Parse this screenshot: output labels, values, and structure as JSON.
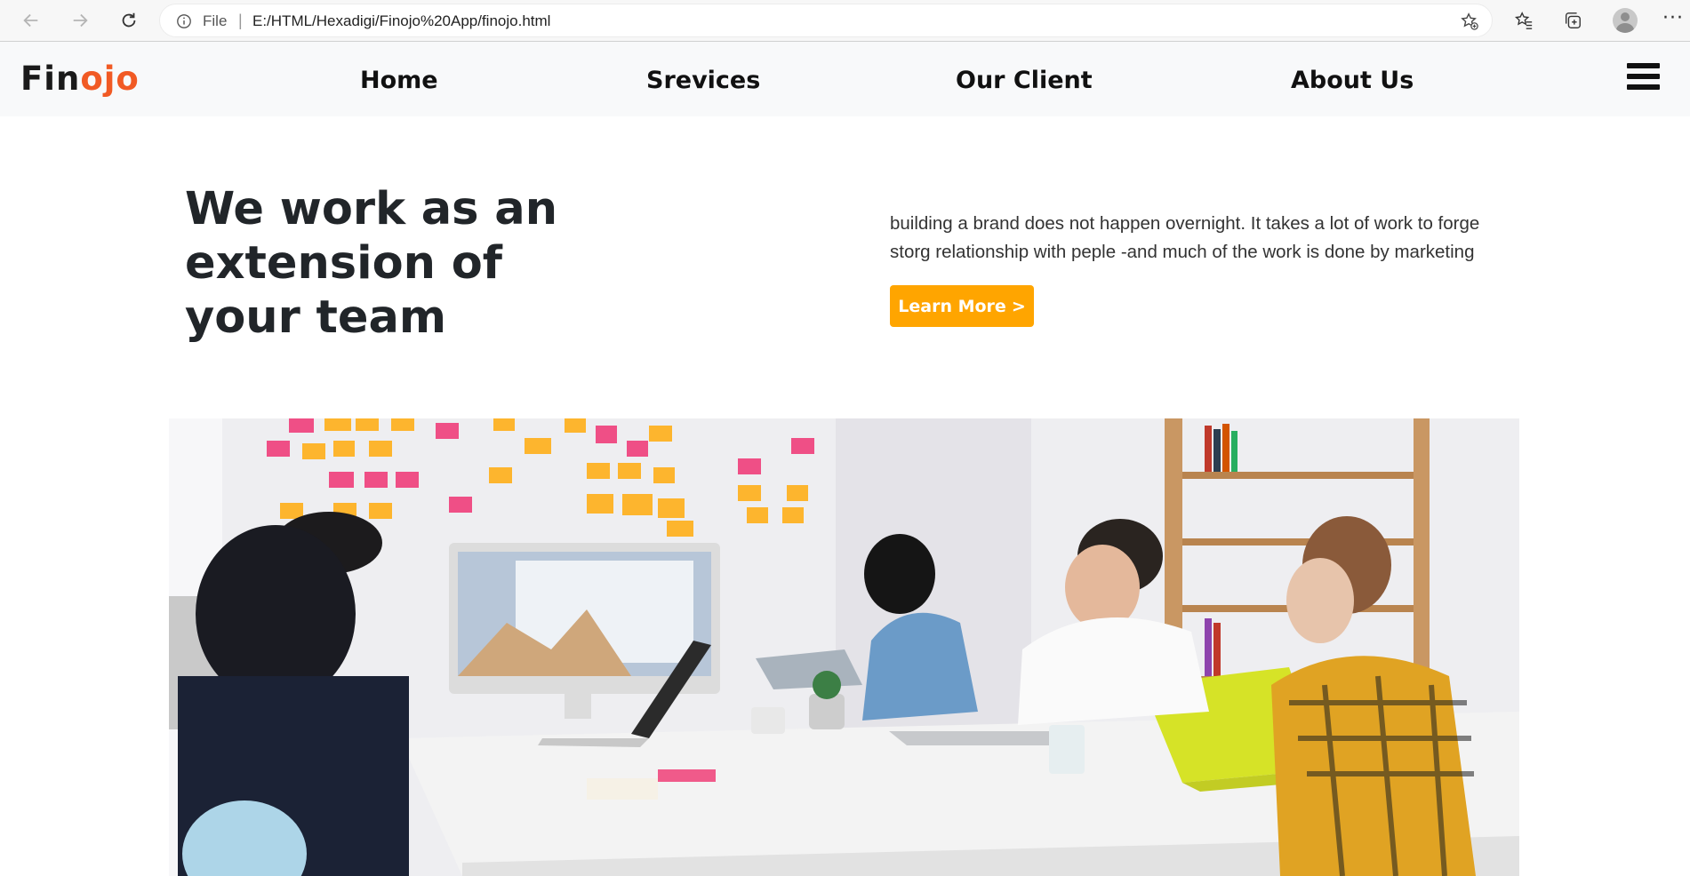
{
  "browser": {
    "file_label": "File",
    "separator": "|",
    "url": "E:/HTML/Hexadigi/Finojo%20App/finojo.html",
    "menu_dots": "···"
  },
  "site": {
    "logo_part1": "Fin",
    "logo_part2": "ojo",
    "nav": [
      "Home",
      "Srevices",
      "Our Client",
      "About Us"
    ]
  },
  "hero": {
    "headline": [
      "We work as an",
      "extension of",
      "your team"
    ],
    "paragraph": [
      "building a brand does not happen overnight. It takes a lot of work to forge",
      "storg relationship with peple -and much of the work is done by marketing"
    ],
    "button_label": "Learn More",
    "button_arrow": ">"
  },
  "colors": {
    "accent": "#ffa500",
    "logo_accent": "#f15a24",
    "nav_bg": "#f8f9fa"
  },
  "icons": [
    "back-icon",
    "forward-icon",
    "reload-icon",
    "info-icon",
    "add-favorite-icon",
    "favorites-icon",
    "collections-icon",
    "profile-icon",
    "more-icon",
    "hamburger-icon"
  ]
}
